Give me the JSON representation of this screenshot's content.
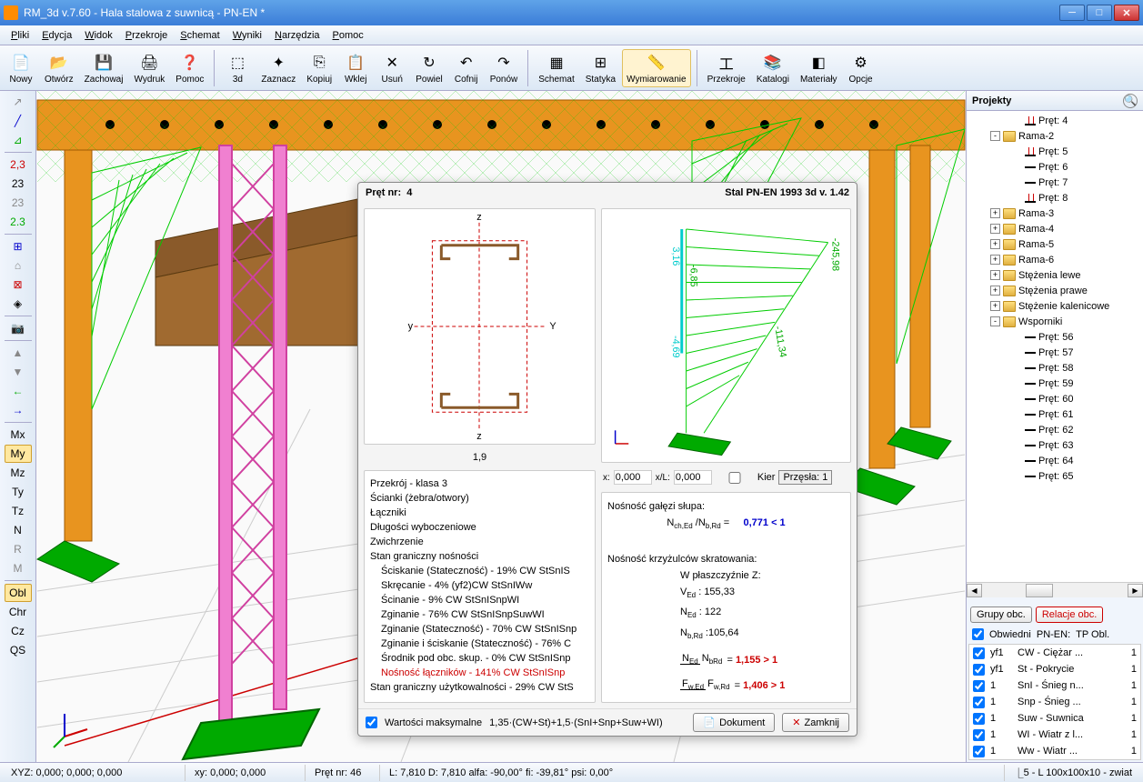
{
  "window": {
    "title": "RM_3d v.7.60 - Hala stalowa z suwnicą - PN-EN *"
  },
  "menu": [
    "Pliki",
    "Edycja",
    "Widok",
    "Przekroje",
    "Schemat",
    "Wyniki",
    "Narzędzia",
    "Pomoc"
  ],
  "toolbar": [
    {
      "label": "Nowy",
      "icon": "📄"
    },
    {
      "label": "Otwórz",
      "icon": "📂"
    },
    {
      "label": "Zachowaj",
      "icon": "💾"
    },
    {
      "label": "Wydruk",
      "icon": "🖨"
    },
    {
      "label": "Pomoc",
      "icon": "❓"
    },
    {
      "sep": true
    },
    {
      "label": "3d",
      "icon": "⬚"
    },
    {
      "label": "Zaznacz",
      "icon": "✦"
    },
    {
      "label": "Kopiuj",
      "icon": "⎘"
    },
    {
      "label": "Wklej",
      "icon": "📋"
    },
    {
      "label": "Usuń",
      "icon": "✕"
    },
    {
      "label": "Powiel",
      "icon": "↻"
    },
    {
      "label": "Cofnij",
      "icon": "↶"
    },
    {
      "label": "Ponów",
      "icon": "↷"
    },
    {
      "sep": true
    },
    {
      "label": "Schemat",
      "icon": "▦"
    },
    {
      "label": "Statyka",
      "icon": "⊞"
    },
    {
      "label": "Wymiarowanie",
      "icon": "📏",
      "active": true
    },
    {
      "sep": true
    },
    {
      "label": "Przekroje",
      "icon": "工"
    },
    {
      "label": "Katalogi",
      "icon": "📚"
    },
    {
      "label": "Materiały",
      "icon": "◧"
    },
    {
      "label": "Opcje",
      "icon": "⚙"
    }
  ],
  "lefttools": [
    {
      "t": "↗",
      "c": "#888"
    },
    {
      "t": "╱",
      "c": "#00c"
    },
    {
      "t": "⊿",
      "c": "#0a0"
    },
    {
      "sep": true
    },
    {
      "t": "2,3",
      "c": "#c00"
    },
    {
      "t": "23",
      "c": "#000"
    },
    {
      "t": "23",
      "c": "#888"
    },
    {
      "t": "2.3",
      "c": "#0a0"
    },
    {
      "sep": true
    },
    {
      "t": "⊞",
      "c": "#00c"
    },
    {
      "t": "⌂",
      "c": "#888"
    },
    {
      "t": "⊠",
      "c": "#c00"
    },
    {
      "t": "◈",
      "c": "#000"
    },
    {
      "sep": true
    },
    {
      "t": "📷",
      "c": "#000"
    },
    {
      "sep": true
    },
    {
      "t": "▲",
      "c": "#888"
    },
    {
      "t": "▼",
      "c": "#888"
    },
    {
      "t": "←",
      "c": "#0a0"
    },
    {
      "t": "→",
      "c": "#00c"
    },
    {
      "sep": true
    },
    {
      "t": "Mx",
      "c": "#000"
    },
    {
      "t": "My",
      "c": "#000",
      "sel": true
    },
    {
      "t": "Mz",
      "c": "#000"
    },
    {
      "t": "Ty",
      "c": "#000"
    },
    {
      "t": "Tz",
      "c": "#000"
    },
    {
      "t": "N",
      "c": "#000"
    },
    {
      "t": "R",
      "c": "#888"
    },
    {
      "t": "M",
      "c": "#888"
    },
    {
      "sep": true
    },
    {
      "t": "Obl",
      "c": "#000",
      "sel": true
    },
    {
      "t": "Chr",
      "c": "#000"
    },
    {
      "t": "Cz",
      "c": "#000"
    },
    {
      "t": "QS",
      "c": "#000"
    }
  ],
  "projects": {
    "title": "Projekty",
    "tree": [
      {
        "d": 4,
        "ic": "pretR",
        "label": "Pręt: 4"
      },
      {
        "d": 2,
        "exp": "-",
        "ic": "folder",
        "label": "Rama-2"
      },
      {
        "d": 4,
        "ic": "pretR",
        "label": "Pręt: 5"
      },
      {
        "d": 4,
        "ic": "pret",
        "label": "Pręt: 6"
      },
      {
        "d": 4,
        "ic": "pret",
        "label": "Pręt: 7"
      },
      {
        "d": 4,
        "ic": "pretR",
        "label": "Pręt: 8"
      },
      {
        "d": 2,
        "exp": "+",
        "ic": "folder",
        "label": "Rama-3"
      },
      {
        "d": 2,
        "exp": "+",
        "ic": "folder",
        "label": "Rama-4"
      },
      {
        "d": 2,
        "exp": "+",
        "ic": "folder",
        "label": "Rama-5"
      },
      {
        "d": 2,
        "exp": "+",
        "ic": "folder",
        "label": "Rama-6"
      },
      {
        "d": 2,
        "exp": "+",
        "ic": "folder",
        "label": "Stężenia lewe"
      },
      {
        "d": 2,
        "exp": "+",
        "ic": "folder",
        "label": "Stężenia prawe"
      },
      {
        "d": 2,
        "exp": "+",
        "ic": "folder",
        "label": "Stężenie kalenicowe"
      },
      {
        "d": 2,
        "exp": "-",
        "ic": "folder",
        "label": "Wsporniki"
      },
      {
        "d": 4,
        "ic": "pret",
        "label": "Pręt: 56"
      },
      {
        "d": 4,
        "ic": "pret",
        "label": "Pręt: 57"
      },
      {
        "d": 4,
        "ic": "pret",
        "label": "Pręt: 58"
      },
      {
        "d": 4,
        "ic": "pret",
        "label": "Pręt: 59"
      },
      {
        "d": 4,
        "ic": "pret",
        "label": "Pręt: 60"
      },
      {
        "d": 4,
        "ic": "pret",
        "label": "Pręt: 61"
      },
      {
        "d": 4,
        "ic": "pret",
        "label": "Pręt: 62"
      },
      {
        "d": 4,
        "ic": "pret",
        "label": "Pręt: 63"
      },
      {
        "d": 4,
        "ic": "pret",
        "label": "Pręt: 64"
      },
      {
        "d": 4,
        "ic": "pret",
        "label": "Pręt: 65"
      }
    ]
  },
  "groups": {
    "btn1": "Grupy obc.",
    "btn2": "Relacje obc.",
    "obw": "Obwiedni",
    "pnen": "PN-EN:",
    "tp": "TP Obl."
  },
  "loads": [
    {
      "c": "yf1",
      "d": "CW - Ciężar ...",
      "v": "1"
    },
    {
      "c": "yf1",
      "d": "St - Pokrycie",
      "v": "1"
    },
    {
      "c": "1",
      "d": "SnI - Śnieg n...",
      "v": "1"
    },
    {
      "c": "1",
      "d": "Snp - Śnieg ...",
      "v": "1"
    },
    {
      "c": "1",
      "d": "Suw - Suwnica",
      "v": "1"
    },
    {
      "c": "1",
      "d": "WI - Wiatr z l...",
      "v": "1"
    },
    {
      "c": "1",
      "d": "Ww - Wiatr ...",
      "v": "1"
    }
  ],
  "status": {
    "xyz": "XYZ: 0,000; 0,000; 0,000",
    "xy": "xy: 0,000; 0,000",
    "pret": "Pręt nr: 46",
    "L": "L: 7,810 D: 7,810 alfa: -90,00° fi: -39,81° psi: 0,00°",
    "sect": "5 - L 100x100x10 - zwiat"
  },
  "dialog": {
    "pretnr": "Pręt nr:",
    "pretval": "4",
    "norm": "Stal PN-EN 1993 3d v. 1.42",
    "sectwidth": "1,9",
    "results": [
      {
        "t": "Przekrój - klasa 3"
      },
      {
        "t": "Ścianki (żebra/otwory)"
      },
      {
        "t": "Łączniki"
      },
      {
        "t": "Długości wyboczeniowe"
      },
      {
        "t": "Zwichrzenie"
      },
      {
        "t": "Stan graniczny nośności"
      },
      {
        "t": "Ściskanie (Stateczność) - 19%   CW StSnIS",
        "ind": true
      },
      {
        "t": "Skręcanie - 4%   (yf2)CW StSnIWw",
        "ind": true
      },
      {
        "t": "Ścinanie - 9%   CW StSnISnpWI",
        "ind": true
      },
      {
        "t": "Zginanie - 76%   CW StSnISnpSuwWI",
        "ind": true
      },
      {
        "t": "Zginanie (Stateczność) - 70%   CW StSnISnp",
        "ind": true
      },
      {
        "t": "Zginanie i ściskanie (Stateczność) - 76%   C",
        "ind": true
      },
      {
        "t": "Środnik pod obc. skup. - 0%   CW StSnISnp",
        "ind": true
      },
      {
        "t": "Nośność łączników - 141%   CW StSnISnp",
        "ind": true,
        "red": true
      },
      {
        "t": "Stan graniczny użytkowalności - 29%   CW StS"
      }
    ],
    "coordx": "0,000",
    "coordxL": "0,000",
    "kier": "Kier",
    "przesla": "Przęsła: 1",
    "nosgal": "Nośność gałęzi słupa:",
    "nchned": "N",
    "chEd": "ch,Ed",
    "nbRd": "N",
    "bRd": "b,Rd",
    "eqv": "0,771 < 1",
    "noskrz": "Nośność krzyżulców skratowania:",
    "wpl": "W płaszczyźnie Z:",
    "ved": "V",
    "edlbl": "Ed",
    "vedv": "155,33",
    "ned": "N",
    "nedv": "122",
    "nbrd2": "N",
    "brdlbl": "b,Rd",
    "nbrdv": "105,64",
    "r1": "1,155 > 1",
    "r2": "1,406 > 1",
    "maxval": "Wartości maksymalne",
    "combo": "1,35·(CW+St)+1,5·(SnI+Snp+Suw+WI)",
    "dokument": "Dokument",
    "zamknij": "Zamknij"
  }
}
